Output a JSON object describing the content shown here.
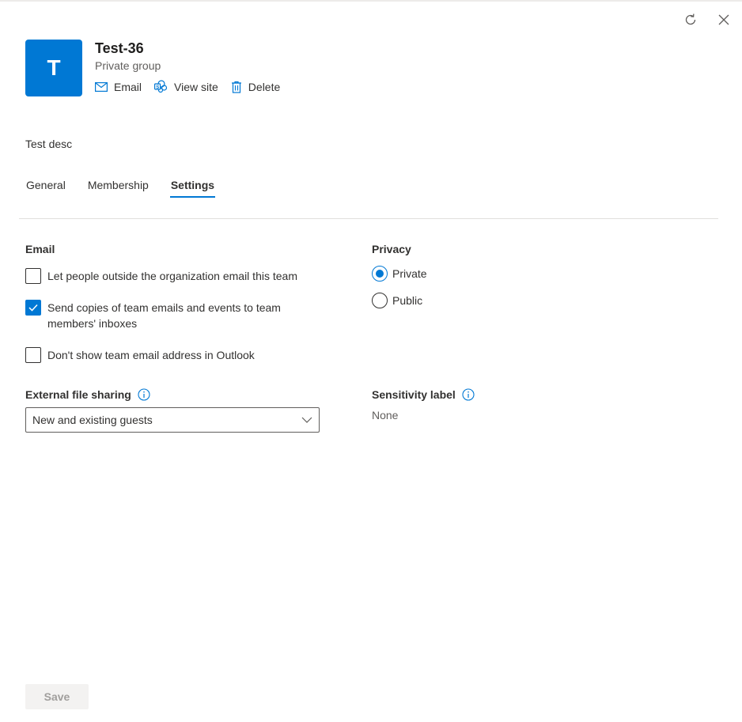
{
  "group": {
    "avatar_letter": "T",
    "title": "Test-36",
    "subtitle": "Private group",
    "description": "Test desc"
  },
  "actions": {
    "email_label": "Email",
    "view_site_label": "View site",
    "delete_label": "Delete"
  },
  "panel": {
    "refresh_icon": "refresh-icon",
    "close_icon": "close-icon"
  },
  "tabs": [
    {
      "label": "General",
      "active": false
    },
    {
      "label": "Membership",
      "active": false
    },
    {
      "label": "Settings",
      "active": true
    }
  ],
  "email_section": {
    "heading": "Email",
    "options": [
      {
        "label": "Let people outside the organization email this team",
        "checked": false
      },
      {
        "label": "Send copies of team emails and events to team members' inboxes",
        "checked": true
      },
      {
        "label": "Don't show team email address in Outlook",
        "checked": false
      }
    ]
  },
  "privacy_section": {
    "heading": "Privacy",
    "options": [
      {
        "label": "Private",
        "selected": true
      },
      {
        "label": "Public",
        "selected": false
      }
    ]
  },
  "external_sharing": {
    "label": "External file sharing",
    "selected_value": "New and existing guests"
  },
  "sensitivity": {
    "label": "Sensitivity label",
    "value": "None"
  },
  "footer": {
    "save_label": "Save"
  },
  "colors": {
    "accent": "#0078d4",
    "text": "#323130",
    "disabled_bg": "#f3f2f1",
    "disabled_text": "#a19f9d"
  }
}
